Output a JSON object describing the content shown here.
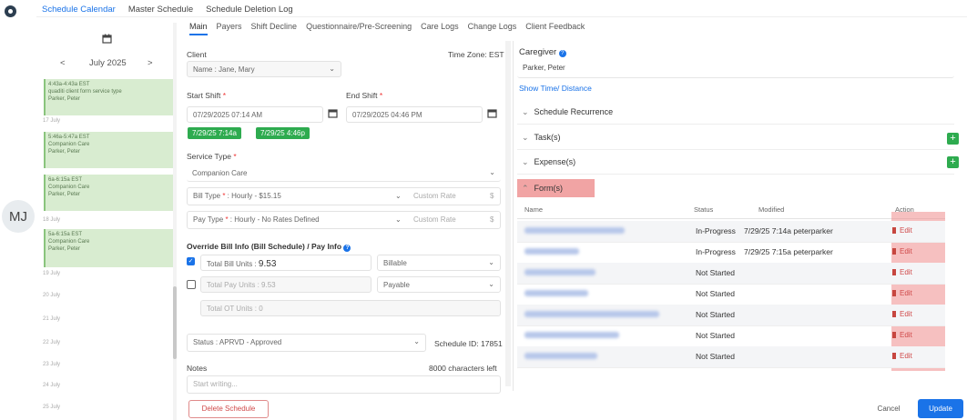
{
  "top_tabs": [
    "Schedule Calendar",
    "Master Schedule",
    "Schedule Deletion Log"
  ],
  "avatar_initials": "MJ",
  "calendar": {
    "month_label": "July 2025",
    "prev": "<",
    "next": ">",
    "events": [
      {
        "time": "4:43a-4:43a EST",
        "service": "quaditi client form service type",
        "caregiver": "Parker, Peter"
      },
      {
        "time": "5:46a-5:47a EST",
        "service": "Companion Care",
        "caregiver": "Parker, Peter"
      },
      {
        "time": "6a-6:15a EST",
        "service": "Companion Care",
        "caregiver": "Parker, Peter"
      },
      {
        "time": "5a-6:15a EST",
        "service": "Companion Care",
        "caregiver": "Parker, Peter"
      }
    ],
    "days": [
      "17 July",
      "18 July",
      "19 July",
      "20 July",
      "21 July",
      "22 July",
      "23 July",
      "24 July",
      "25 July"
    ]
  },
  "sub_tabs": [
    "Main",
    "Payers",
    "Shift Decline",
    "Questionnaire/Pre-Screening",
    "Care Logs",
    "Change Logs",
    "Client Feedback"
  ],
  "client": {
    "label": "Client",
    "timezone": "Time Zone: EST",
    "name_label": "Name",
    "name_value": "Jane, Mary"
  },
  "shift": {
    "start_label": "Start Shift",
    "start_value": "07/29/2025 07:14 AM",
    "end_label": "End Shift",
    "end_value": "07/29/2025 04:46 PM",
    "chip_start": "7/29/25 7:14a",
    "chip_end": "7/29/25 4:46p"
  },
  "service": {
    "label": "Service Type",
    "value": "Companion Care",
    "bill_type_label": "Bill Type",
    "bill_type_value": "Hourly - $15.15",
    "bill_custom": "Custom Rate",
    "pay_type_label": "Pay Type",
    "pay_type_value": "Hourly - No Rates Defined",
    "pay_custom": "Custom Rate",
    "currency": "$"
  },
  "override": {
    "label": "Override Bill Info (Bill Schedule) / Pay Info",
    "bill_units_label": "Total Bill Units",
    "bill_units_value": "9.53",
    "billable": "Billable",
    "pay_units_label": "Total Pay Units",
    "pay_units_value": "9.53",
    "payable": "Payable",
    "ot_units_label": "Total OT Units",
    "ot_units_value": "0"
  },
  "status": {
    "label": "Status",
    "value": "APRVD - Approved",
    "schedule_id": "Schedule ID: 17851"
  },
  "notes": {
    "label": "Notes",
    "chars_left": "8000 characters left",
    "placeholder": "Start writing..."
  },
  "delete_button": "Delete Schedule",
  "caregiver": {
    "label": "Caregiver",
    "value": "Parker, Peter",
    "link": "Show Time/ Distance"
  },
  "sections": {
    "recurrence": "Schedule Recurrence",
    "tasks": "Task(s)",
    "expenses": "Expense(s)",
    "forms": "Form(s)"
  },
  "forms_table": {
    "headers": [
      "Name",
      "Status",
      "Modified",
      "Action"
    ],
    "rows": [
      {
        "status": "In-Progress",
        "modified": "7/29/25 7:14a peterparker",
        "action": "Edit"
      },
      {
        "status": "In-Progress",
        "modified": "7/29/25 7:15a peterparker",
        "action": "Edit"
      },
      {
        "status": "Not Started",
        "modified": "",
        "action": "Edit"
      },
      {
        "status": "Not Started",
        "modified": "",
        "action": "Edit"
      },
      {
        "status": "Not Started",
        "modified": "",
        "action": "Edit"
      },
      {
        "status": "Not Started",
        "modified": "",
        "action": "Edit"
      },
      {
        "status": "Not Started",
        "modified": "",
        "action": "Edit"
      }
    ]
  },
  "footer": {
    "cancel": "Cancel",
    "update": "Update"
  },
  "colors": {
    "accent": "#1a73e8",
    "green": "#2eab4f",
    "highlight": "#f1a4a4"
  }
}
